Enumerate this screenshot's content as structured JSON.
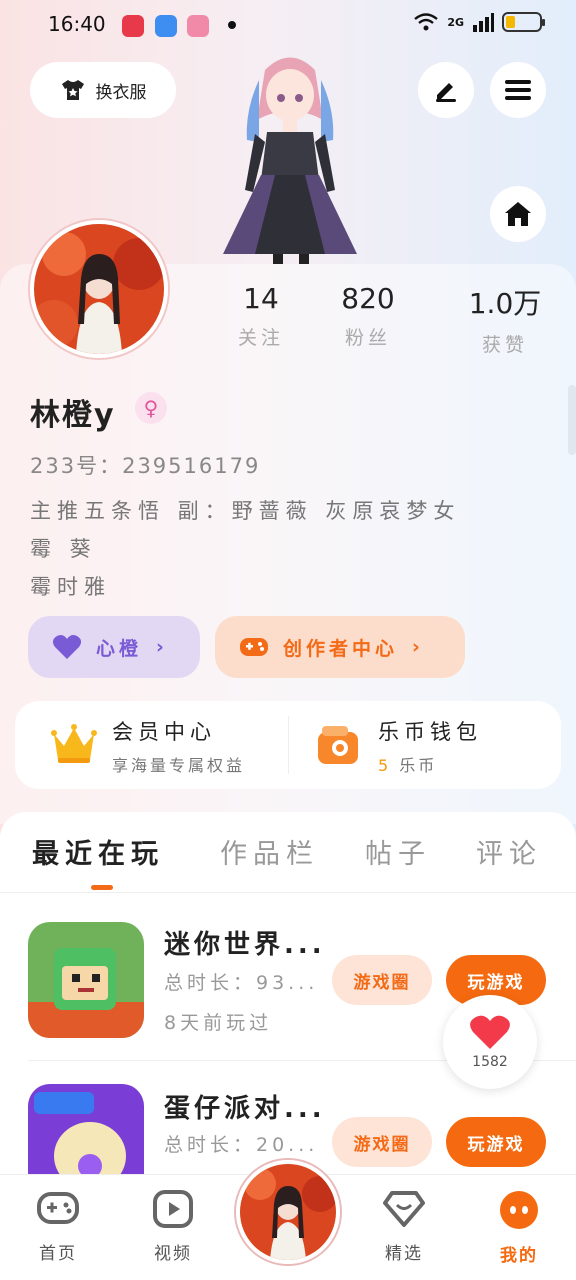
{
  "status_bar": {
    "time": "16:40",
    "network": "2G",
    "colors": {
      "app1": "#e8394a",
      "app2": "#3d8ef0",
      "app3": "#f08aa8"
    }
  },
  "header": {
    "dress_button_label": "换衣服",
    "icons": [
      "edit-icon",
      "menu-icon",
      "home-icon"
    ]
  },
  "profile": {
    "stats": [
      {
        "value": "14",
        "label": "关注"
      },
      {
        "value": "820",
        "label": "粉丝"
      },
      {
        "value": "1.0万",
        "label": "获赞"
      }
    ],
    "name": "林橙y",
    "gender_symbol": "♀",
    "uid": "233号：239516179",
    "bio": "主推五条悟  副：野蔷薇  灰原哀梦女\n霉  葵\n霉时雅"
  },
  "actions": {
    "heart_label": "心橙",
    "creator_label": "创作者中心"
  },
  "member": {
    "title": "会员中心",
    "subtitle": "享海量专属权益",
    "wallet_title": "乐币钱包",
    "wallet_amount": "5",
    "wallet_unit": "乐币"
  },
  "tabs": [
    {
      "label": "最近在玩"
    },
    {
      "label": "作品栏"
    },
    {
      "label": "帖子"
    },
    {
      "label": "评论"
    }
  ],
  "games": [
    {
      "name": "迷你世界...",
      "duration": "总时长：93...",
      "last_played": "8天前玩过",
      "circle_label": "游戏圈",
      "play_label": "玩游戏"
    },
    {
      "name": "蛋仔派对...",
      "duration": "总时长：20...",
      "circle_label": "游戏圈",
      "play_label": "玩游戏"
    }
  ],
  "like_count": "1582",
  "nav": [
    {
      "label": "首页"
    },
    {
      "label": "视频"
    },
    {
      "label": "精选"
    },
    {
      "label": "我的"
    }
  ],
  "colors": {
    "accent": "#f56a10",
    "purple": "#7a5bd6",
    "text": "#222222"
  }
}
